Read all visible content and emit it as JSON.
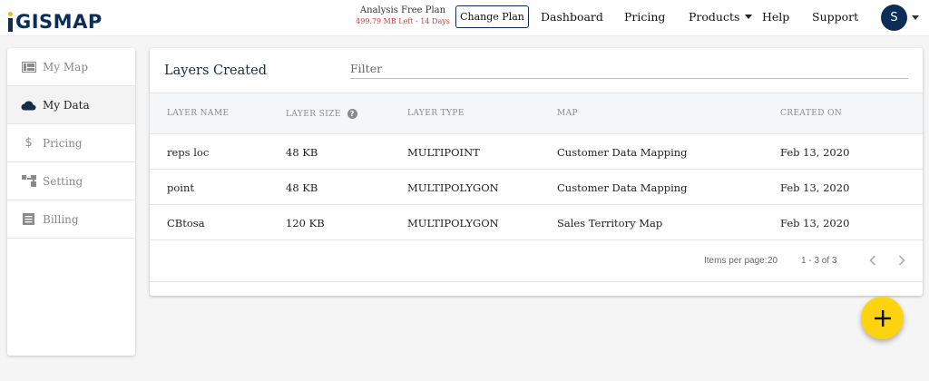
{
  "app": {
    "logo_text": "GISMAP",
    "logo_dot_color": "#f2b705",
    "brand_color": "#0d2d59"
  },
  "header": {
    "plan_name": "Analysis Free Plan",
    "plan_remaining": "499.79 MB Left - 14 Days",
    "change_plan_label": "Change Plan",
    "nav": {
      "dashboard": "Dashboard",
      "pricing": "Pricing",
      "products": "Products",
      "help": "Help",
      "support": "Support"
    },
    "avatar_initial": "S"
  },
  "sidebar": {
    "items": [
      {
        "label": "My Map",
        "icon": "map-icon",
        "active": false
      },
      {
        "label": "My Data",
        "icon": "cloud-icon",
        "active": true
      },
      {
        "label": "Pricing",
        "icon": "dollar-icon",
        "active": false
      },
      {
        "label": "Setting",
        "icon": "settings-icon",
        "active": false
      },
      {
        "label": "Billing",
        "icon": "billing-icon",
        "active": false
      }
    ]
  },
  "layers": {
    "title": "Layers Created",
    "filter_placeholder": "Filter",
    "columns": {
      "name": "LAYER NAME",
      "size": "LAYER SIZE",
      "type": "LAYER TYPE",
      "map": "MAP",
      "created": "CREATED ON"
    },
    "rows": [
      {
        "name": "reps loc",
        "size": "48 KB",
        "type": "MULTIPOINT",
        "map": "Customer Data Mapping",
        "created": "Feb 13, 2020"
      },
      {
        "name": "point",
        "size": "48 KB",
        "type": "MULTIPOLYGON",
        "map": "Customer Data Mapping",
        "created": "Feb 13, 2020"
      },
      {
        "name": "CBtosa",
        "size": "120 KB",
        "type": "MULTIPOLYGON",
        "map": "Sales Territory Map",
        "created": "Feb 13, 2020"
      }
    ],
    "paginator": {
      "items_per_page_label": "Items per page:",
      "page_size": "20",
      "range": "1 - 3 of 3"
    }
  },
  "fab": {
    "icon": "plus-icon",
    "color": "#fdd20e"
  }
}
